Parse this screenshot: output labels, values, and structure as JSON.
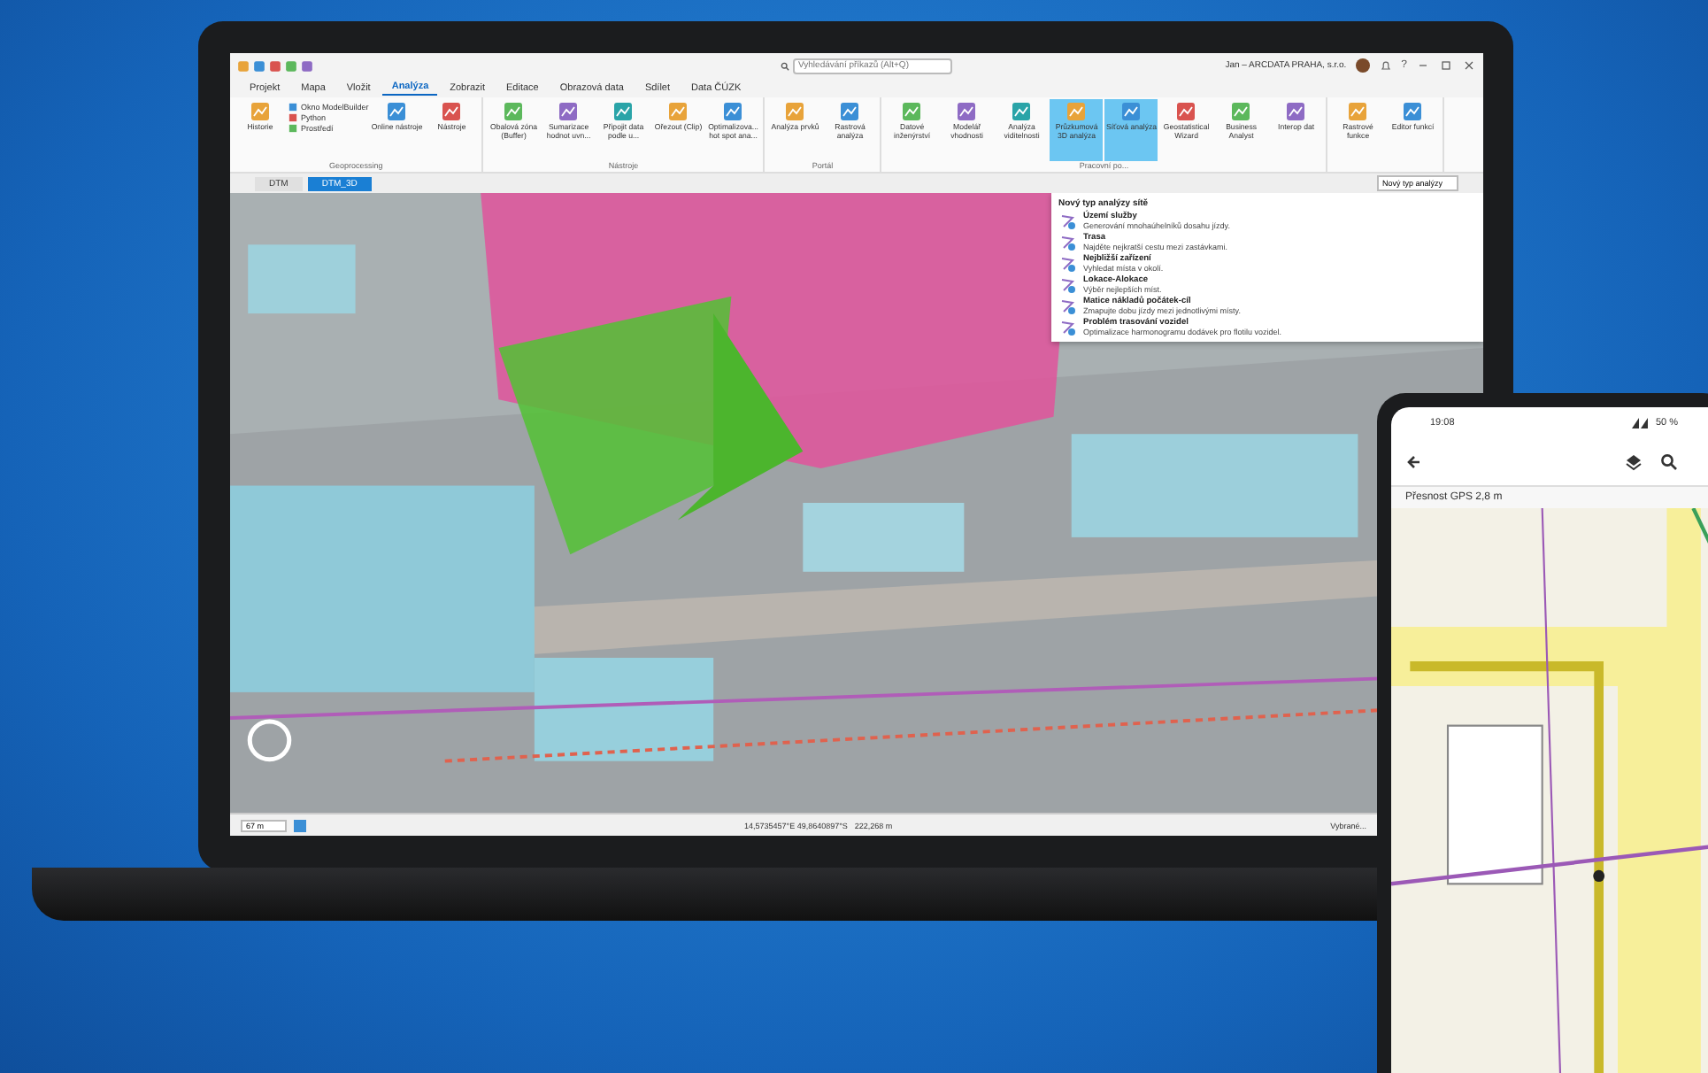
{
  "laptop": {
    "title_bar": {
      "search": {
        "placeholder": "Vyhledávání příkazů (Alt+Q)"
      },
      "user": "Jan – ARCDATA PRAHA, s.r.o.",
      "help": "?"
    },
    "tabs": [
      {
        "label": "Projekt",
        "selected": false
      },
      {
        "label": "Mapa",
        "selected": false
      },
      {
        "label": "Vložit",
        "selected": false
      },
      {
        "label": "Analýza",
        "selected": true
      },
      {
        "label": "Zobrazit",
        "selected": false
      },
      {
        "label": "Editace",
        "selected": false
      },
      {
        "label": "Obrazová data",
        "selected": false
      },
      {
        "label": "Sdílet",
        "selected": false
      },
      {
        "label": "Data ČÚZK",
        "selected": false
      }
    ],
    "groups": [
      {
        "label": "Geoprocessing",
        "tools": [
          {
            "label": "Historie",
            "selected": false
          },
          {
            "label": "Online nástroje",
            "selected": false
          },
          {
            "label": "Nástroje",
            "selected": false
          }
        ],
        "small_tools": [
          "Okno ModelBuilder",
          "Python",
          "Prostředí"
        ]
      },
      {
        "label": "Nástroje",
        "tools": [
          {
            "label": "Obalová zóna (Buffer)",
            "selected": false
          },
          {
            "label": "Sumarizace hodnot uvn...",
            "selected": false
          },
          {
            "label": "Připojit data podle u...",
            "selected": false
          },
          {
            "label": "Ořezout (Clip)",
            "selected": false
          },
          {
            "label": "Optimalizova... hot spot ana...",
            "selected": false
          }
        ]
      },
      {
        "label": "Portál",
        "tools": [
          {
            "label": "Analýza prvků",
            "selected": false
          },
          {
            "label": "Rastrová analýza",
            "selected": false
          }
        ]
      },
      {
        "label": "Pracovní po...",
        "tools": [
          {
            "label": "Datové inženýrství",
            "selected": false
          },
          {
            "label": "Modelář vhodnosti",
            "selected": false
          },
          {
            "label": "Analýza viditelnosti",
            "selected": false
          },
          {
            "label": "Průzkumová 3D analýza",
            "selected": true
          },
          {
            "label": "Síťová analýza",
            "selected": true
          },
          {
            "label": "Geostatistical Wizard",
            "selected": false
          },
          {
            "label": "Business Analyst",
            "selected": false
          },
          {
            "label": "Interop dat",
            "selected": false
          }
        ]
      },
      {
        "tools": [
          {
            "label": "Rastrové funkce",
            "selected": false
          },
          {
            "label": "Editor funkcí",
            "selected": false
          }
        ]
      }
    ],
    "view_tabs": [
      {
        "label": "DTM",
        "selected": false
      },
      {
        "label": "DTM_3D",
        "selected": true
      }
    ],
    "analysis_field": {
      "value": "Nový typ analýzy"
    },
    "menu": {
      "header": "Nový typ analýzy sítě",
      "items": [
        {
          "title": "Území služby",
          "text": "Generování mnohaúhelníků dosahu jízdy."
        },
        {
          "title": "Trasa",
          "text": "Najděte nejkratší cestu mezi zastávkami."
        },
        {
          "title": "Nejbližší zařízení",
          "text": "Vyhledat místa v okolí."
        },
        {
          "title": "Lokace-Alokace",
          "text": "Výběr nejlepších míst."
        },
        {
          "title": "Matice nákladů počátek-cíl",
          "text": "Zmapujte dobu jízdy mezi jednotlivými místy."
        },
        {
          "title": "Problém trasování vozidel",
          "text": "Optimalizace harmonogramu dodávek pro flotilu vozidel."
        }
      ]
    },
    "status_bar": {
      "scale": "67 m",
      "coordinates": "14,5735457°E 49,8640897°S",
      "elevation": "222,268 m",
      "selection": "Vybrané..."
    }
  },
  "phone": {
    "time": "19:08",
    "battery": "50 %",
    "gps_accuracy": "Přesnost GPS 2,8 m"
  }
}
